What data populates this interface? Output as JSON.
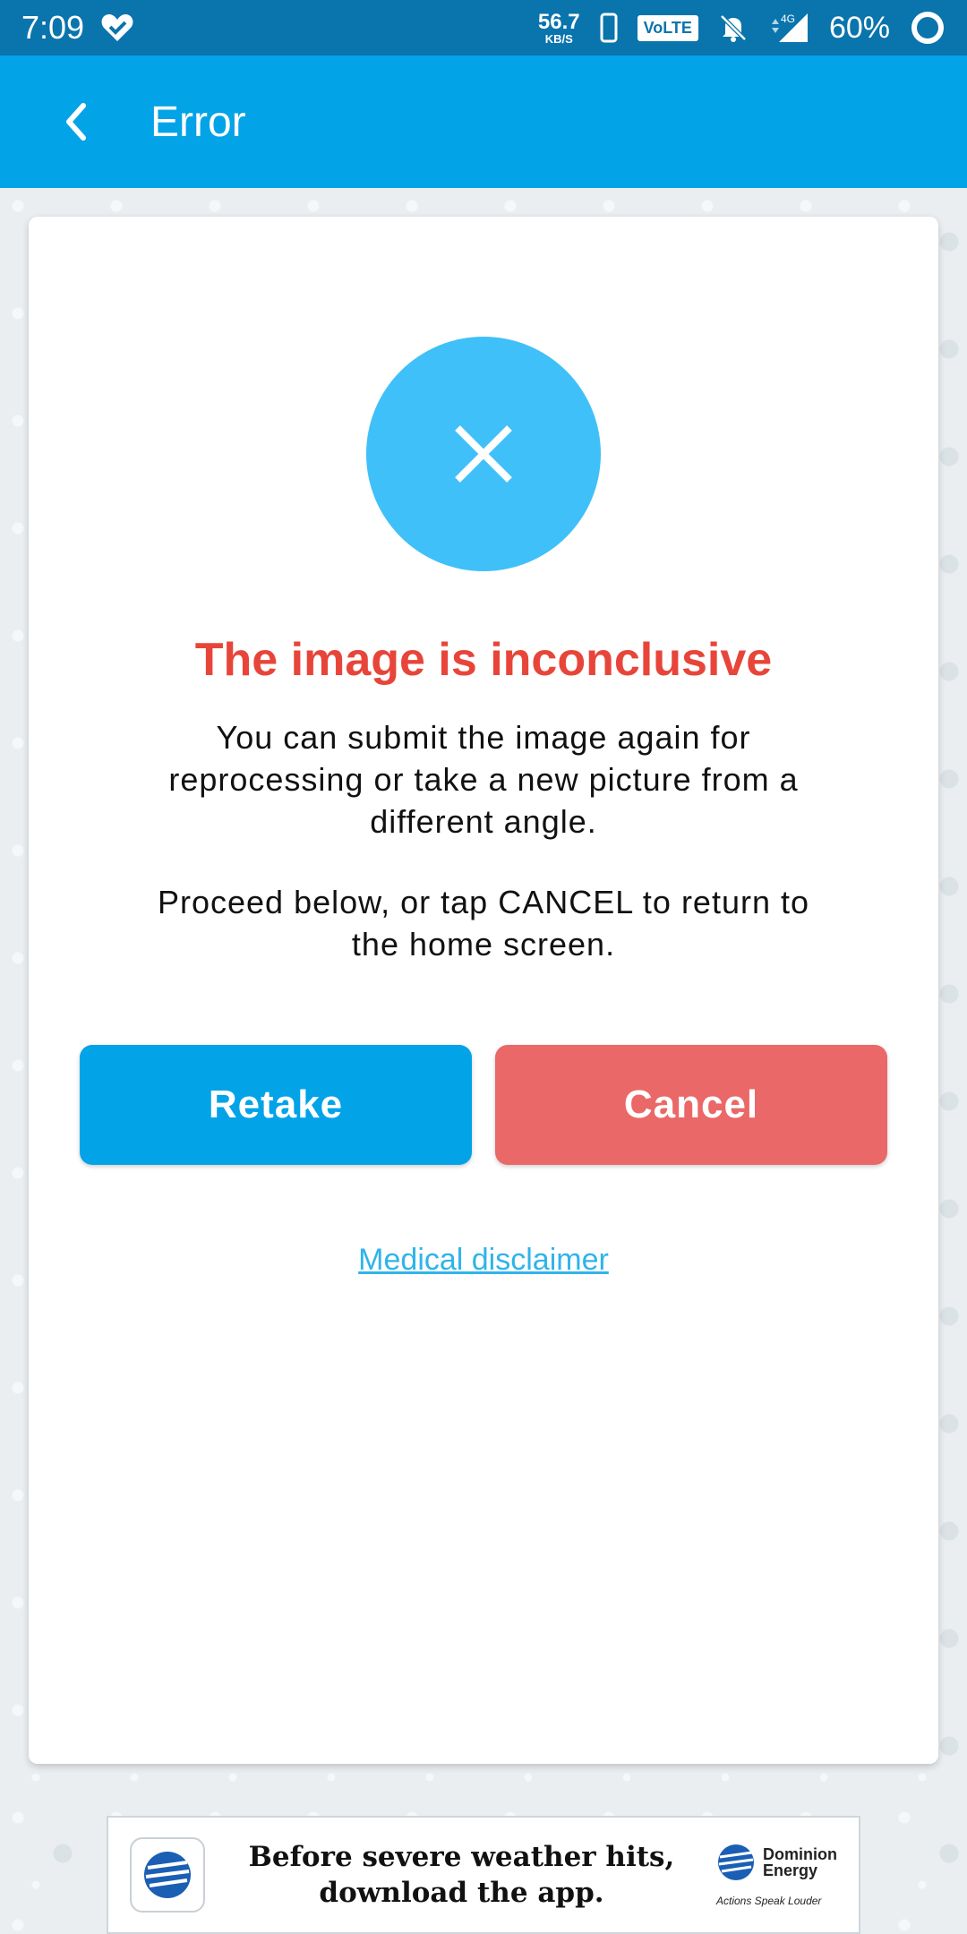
{
  "status_bar": {
    "time": "7:09",
    "net_speed_value": "56.7",
    "net_speed_unit": "KB/S",
    "volte": "VoLTE",
    "network_type": "4G",
    "battery": "60%"
  },
  "app_bar": {
    "title": "Error"
  },
  "card": {
    "headline": "The image is inconclusive",
    "description": "You can submit the image again for reprocessing or take a new picture from a different angle.",
    "instruction": "Proceed below, or tap CANCEL to return to the home screen.",
    "retake_label": "Retake",
    "cancel_label": "Cancel",
    "disclaimer_label": "Medical disclaimer"
  },
  "ad": {
    "line1": "Before severe weather hits,",
    "line2": "download the app.",
    "brand_line1": "Dominion",
    "brand_line2": "Energy",
    "tagline": "Actions Speak Louder"
  },
  "colors": {
    "status_bar": "#0a74ad",
    "app_bar": "#03a3e8",
    "error_circle": "#40c0f8",
    "headline": "#e8453a",
    "retake_button": "#03a3e8",
    "cancel_button": "#ea6868",
    "link": "#2fb4ea"
  },
  "icons": {
    "status_heart": "heart-check-icon",
    "phone": "phone-icon",
    "mute": "bell-off-icon",
    "signal": "signal-icon",
    "battery": "battery-ring-icon",
    "back": "chevron-left-icon",
    "error": "close-icon",
    "ad_app": "dominion-app-icon",
    "ad_logo": "dominion-logo-icon"
  }
}
